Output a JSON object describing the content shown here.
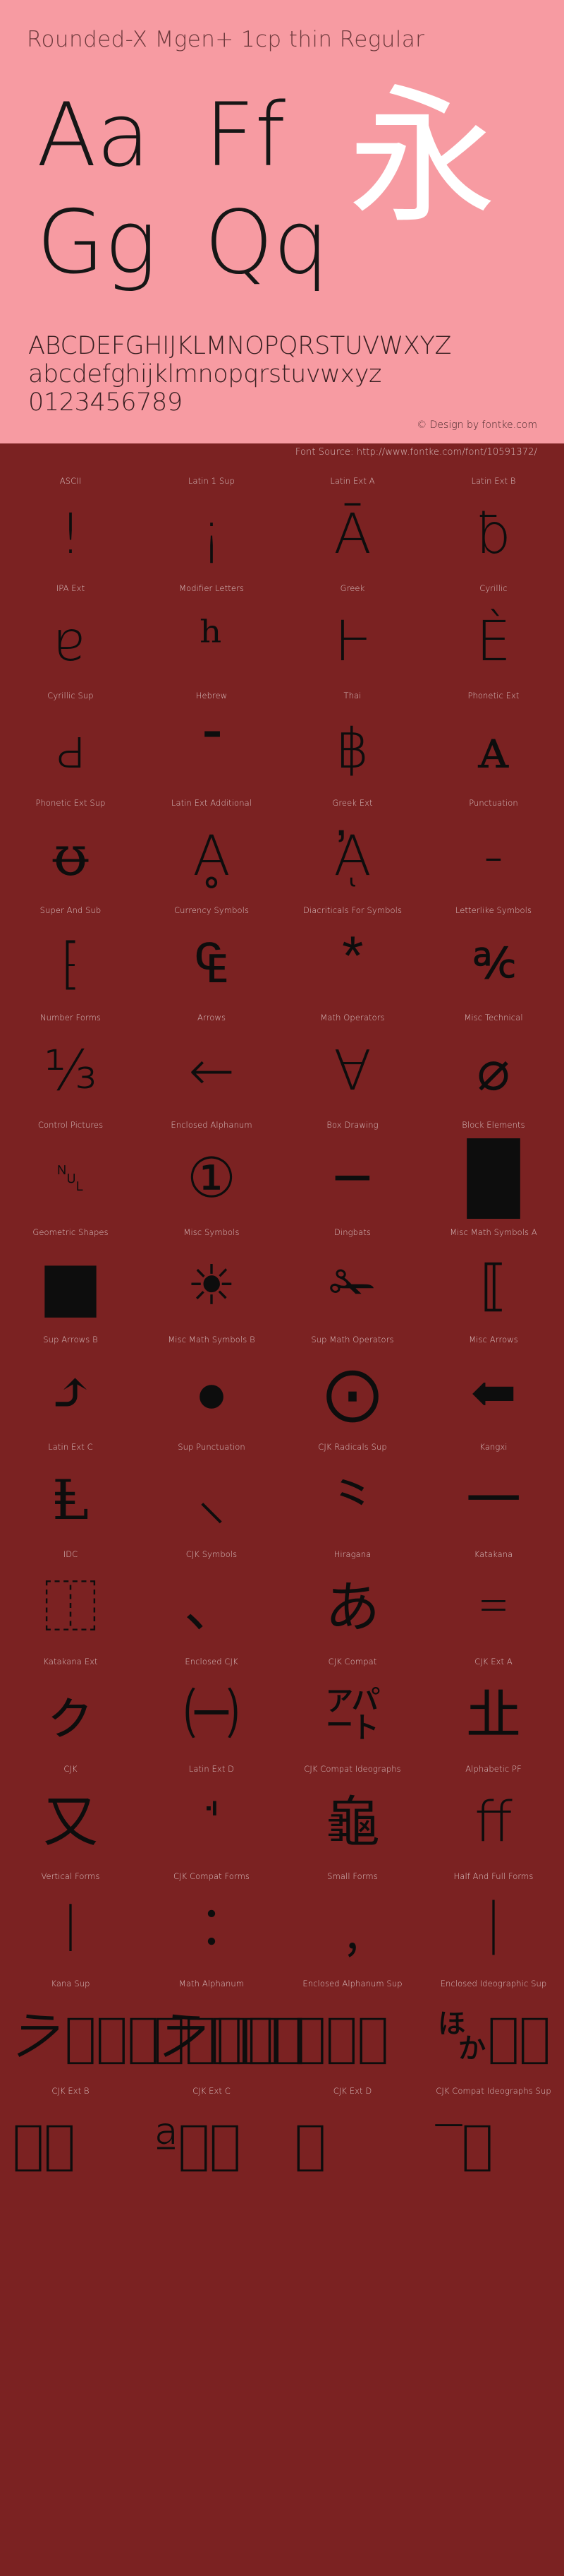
{
  "header": {
    "title": "Rounded-X Mgen+ 1cp thin Regular",
    "specimen_pairs": [
      "Aa",
      "Ff",
      "Gg",
      "Qq"
    ],
    "cjk_sample": "永",
    "alphabet_upper": "ABCDEFGHIJKLMNOPQRSTUVWXYZ",
    "alphabet_lower": "abcdefghijklmnopqrstuvwxyz",
    "digits": "0123456789",
    "design_credit": "© Design by fontke.com",
    "colors": {
      "header_bg": "#f79ba2",
      "body_bg": "#7b2222",
      "title_text": "#6f3a3d",
      "glyph_black": "#0d0d0d",
      "cjk_white": "#ffffff",
      "label_text": "#d9c0c0"
    }
  },
  "source_bar": {
    "text": "Font Source: http://www.fontke.com/font/10591372/"
  },
  "grid": {
    "columns": 4,
    "blocks": [
      {
        "label": "ASCII",
        "glyph": "!",
        "style": ""
      },
      {
        "label": "Latin 1 Sup",
        "glyph": "¡",
        "style": ""
      },
      {
        "label": "Latin Ext A",
        "glyph": "Ā",
        "style": ""
      },
      {
        "label": "Latin Ext B",
        "glyph": "ƀ",
        "style": ""
      },
      {
        "label": "IPA Ext",
        "glyph": "ɐ",
        "style": ""
      },
      {
        "label": "Modifier Letters",
        "glyph": "ʰ",
        "style": ""
      },
      {
        "label": "Greek",
        "glyph": "Ͱ",
        "style": ""
      },
      {
        "label": "Cyrillic",
        "glyph": "Ѐ",
        "style": ""
      },
      {
        "label": "Cyrillic Sup",
        "glyph": "ԁ",
        "style": ""
      },
      {
        "label": "Hebrew",
        "glyph": "־",
        "style": ""
      },
      {
        "label": "Thai",
        "glyph": "฿",
        "style": ""
      },
      {
        "label": "Phonetic Ext",
        "glyph": "ᴀ",
        "style": ""
      },
      {
        "label": "Phonetic Ext Sup",
        "glyph": "ᵿ",
        "style": ""
      },
      {
        "label": "Latin Ext Additional",
        "glyph": "Ḁ",
        "style": ""
      },
      {
        "label": "Greek Ext",
        "glyph": "ᾈ",
        "style": ""
      },
      {
        "label": "Punctuation",
        "glyph": "‐",
        "style": ""
      },
      {
        "label": "Super And Sub",
        "glyph": "⁅",
        "style": ""
      },
      {
        "label": "Currency Symbols",
        "glyph": "₠",
        "style": ""
      },
      {
        "label": "Diacriticals For Symbols",
        "glyph": "⃰",
        "style": ""
      },
      {
        "label": "Letterlike Symbols",
        "glyph": "℀",
        "style": "wide"
      },
      {
        "label": "Number Forms",
        "glyph": "⅓",
        "style": ""
      },
      {
        "label": "Arrows",
        "glyph": "←",
        "style": ""
      },
      {
        "label": "Math Operators",
        "glyph": "∀",
        "style": ""
      },
      {
        "label": "Misc Technical",
        "glyph": "⌀",
        "style": ""
      },
      {
        "label": "Control Pictures",
        "glyph": "␀",
        "style": "small"
      },
      {
        "label": "Enclosed Alphanum",
        "glyph": "①",
        "style": ""
      },
      {
        "label": "Box Drawing",
        "glyph": "─",
        "style": ""
      },
      {
        "label": "Block Elements",
        "glyph": "█",
        "style": "solid-block"
      },
      {
        "label": "Geometric Shapes",
        "glyph": "■",
        "style": "solid-block"
      },
      {
        "label": "Misc Symbols",
        "glyph": "☀",
        "style": ""
      },
      {
        "label": "Dingbats",
        "glyph": "✁",
        "style": ""
      },
      {
        "label": "Misc Math Symbols A",
        "glyph": "⟦",
        "style": ""
      },
      {
        "label": "Sup Arrows B",
        "glyph": "⤴",
        "style": ""
      },
      {
        "label": "Misc Math Symbols B",
        "glyph": "⦁",
        "style": ""
      },
      {
        "label": "Sup Math Operators",
        "glyph": "⨀",
        "style": ""
      },
      {
        "label": "Misc Arrows",
        "glyph": "⬅",
        "style": ""
      },
      {
        "label": "Latin Ext C",
        "glyph": "Ⱡ",
        "style": ""
      },
      {
        "label": "Sup Punctuation",
        "glyph": "⸜",
        "style": ""
      },
      {
        "label": "CJK Radicals Sup",
        "glyph": "⺀",
        "style": ""
      },
      {
        "label": "Kangxi",
        "glyph": "⼀",
        "style": ""
      },
      {
        "label": "IDC",
        "glyph": "⿰",
        "style": ""
      },
      {
        "label": "CJK Symbols",
        "glyph": "、",
        "style": ""
      },
      {
        "label": "Hiragana",
        "glyph": "あ",
        "style": ""
      },
      {
        "label": "Katakana",
        "glyph": "゠",
        "style": ""
      },
      {
        "label": "Katakana Ext",
        "glyph": "ㇰ",
        "style": ""
      },
      {
        "label": "Enclosed CJK",
        "glyph": "㈠",
        "style": ""
      },
      {
        "label": "CJK Compat",
        "glyph": "㌀",
        "style": ""
      },
      {
        "label": "CJK Ext A",
        "glyph": "㐀",
        "style": ""
      },
      {
        "label": "CJK",
        "glyph": "又",
        "style": ""
      },
      {
        "label": "Latin Ext D",
        "glyph": "ꜗ",
        "style": ""
      },
      {
        "label": "CJK Compat Ideographs",
        "glyph": "龜",
        "style": ""
      },
      {
        "label": "Alphabetic PF",
        "glyph": "ﬀ",
        "style": ""
      },
      {
        "label": "Vertical Forms",
        "glyph": "︱",
        "style": ""
      },
      {
        "label": "CJK Compat Forms",
        "glyph": "︰",
        "style": ""
      },
      {
        "label": "Small Forms",
        "glyph": "﹐",
        "style": ""
      },
      {
        "label": "Half And Full Forms",
        "glyph": "｜",
        "style": ""
      },
      {
        "label": "Kana Sup",
        "glyph": "𛀀􀀀􀀀􀀀𛀀􀀀􀀀􀀀",
        "style": "overflow-row"
      },
      {
        "label": "Math Alphanum",
        "glyph": "𝐀􀀀􀀀􀀀",
        "style": "overflow-row"
      },
      {
        "label": "Enclosed Alphanum Sup",
        "glyph": "🄀􀀀􀀀",
        "style": "overflow-row"
      },
      {
        "label": "Enclosed Ideographic Sup",
        "glyph": "🈀􀀀􀀀",
        "style": "overflow-row"
      },
      {
        "label": "CJK Ext B",
        "glyph": "𠀀􀀀􀀀",
        "style": "overflow-row"
      },
      {
        "label": "CJK Ext C",
        "glyph": "𪜀ª􀀀􀀀",
        "style": "overflow-row"
      },
      {
        "label": "CJK Ext D",
        "glyph": "𫝀《􀀀",
        "style": "overflow-row"
      },
      {
        "label": "CJK Compat Ideographs Sup",
        "glyph": "𪠀‾􀀀",
        "style": "overflow-row"
      }
    ]
  }
}
